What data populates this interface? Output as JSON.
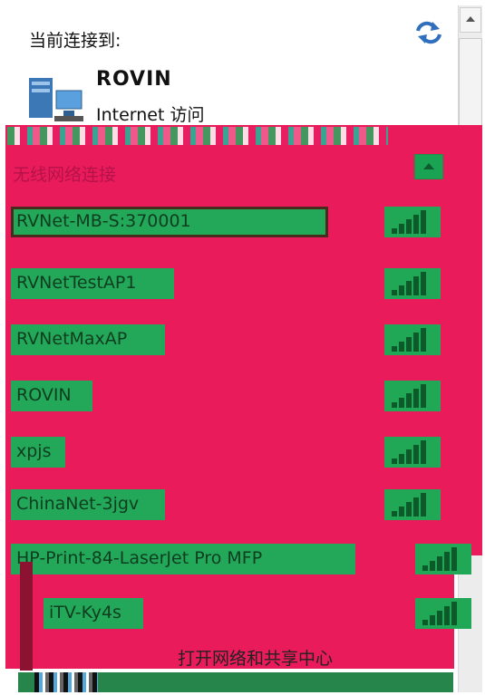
{
  "current": {
    "label": "当前连接到:",
    "network_name": "ROVIN",
    "access": "Internet 访问"
  },
  "wireless": {
    "section_title": "无线网络连接",
    "networks": [
      {
        "name": "RVNet-MB-S:370001",
        "signal_bars": 5,
        "selected": true
      },
      {
        "name": "RVNetTestAP1",
        "signal_bars": 5,
        "selected": false
      },
      {
        "name": "RVNetMaxAP",
        "signal_bars": 5,
        "selected": false
      },
      {
        "name": "ROVIN",
        "signal_bars": 5,
        "selected": false
      },
      {
        "name": "xpjs",
        "signal_bars": 5,
        "selected": false
      },
      {
        "name": "ChinaNet-3jgv",
        "signal_bars": 5,
        "selected": false
      },
      {
        "name": "HP-Print-84-LaserJet Pro MFP",
        "signal_bars": 5,
        "selected": false
      },
      {
        "name": "iTV-Ky4s",
        "signal_bars": 5,
        "selected": false
      }
    ]
  },
  "footer": {
    "link": "打开网络和共享中心"
  },
  "icons": {
    "refresh": "refresh-icon",
    "network": "network-computer-icon",
    "collapse": "chevron-up-icon",
    "signal": "wifi-signal-icon"
  },
  "colors": {
    "overlay": "#ea1b5a",
    "row": "#23a85a",
    "selected_border": "#4a2a1d"
  }
}
